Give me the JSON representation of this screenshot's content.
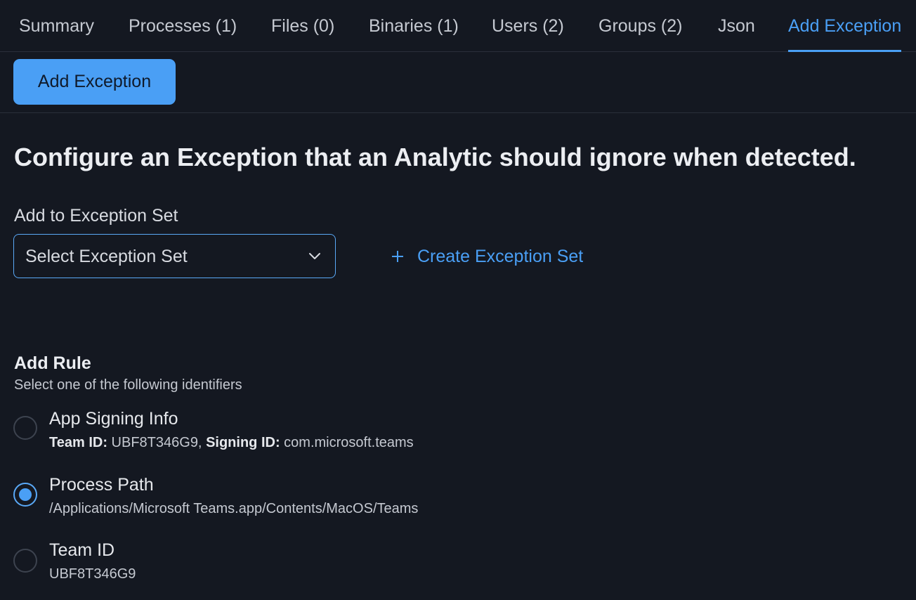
{
  "tabs": [
    {
      "label": "Summary"
    },
    {
      "label": "Processes (1)"
    },
    {
      "label": "Files (0)"
    },
    {
      "label": "Binaries (1)"
    },
    {
      "label": "Users (2)"
    },
    {
      "label": "Groups (2)"
    },
    {
      "label": "Json"
    },
    {
      "label": "Add Exception",
      "active": true
    }
  ],
  "toolbar": {
    "add_exception_button": "Add Exception"
  },
  "page": {
    "title": "Configure an Exception that an Analytic should ignore when detected."
  },
  "exception_set": {
    "label": "Add to Exception Set",
    "select_value": "Select Exception Set",
    "create_link": "Create Exception Set"
  },
  "rule": {
    "title": "Add Rule",
    "subtitle": "Select one of the following identifiers",
    "options": [
      {
        "label": "App Signing Info",
        "team_id_key": "Team ID:",
        "team_id_value": "UBF8T346G9,",
        "signing_id_key": "Signing ID:",
        "signing_id_value": "com.microsoft.teams",
        "checked": false
      },
      {
        "label": "Process Path",
        "detail": "/Applications/Microsoft Teams.app/Contents/MacOS/Teams",
        "checked": true
      },
      {
        "label": "Team ID",
        "detail": "UBF8T346G9",
        "checked": false
      }
    ]
  },
  "colors": {
    "accent": "#4a9ff5",
    "background": "#141821",
    "divider": "#2a2f3a"
  },
  "icons": [
    "chevron-down-icon",
    "plus-icon"
  ]
}
